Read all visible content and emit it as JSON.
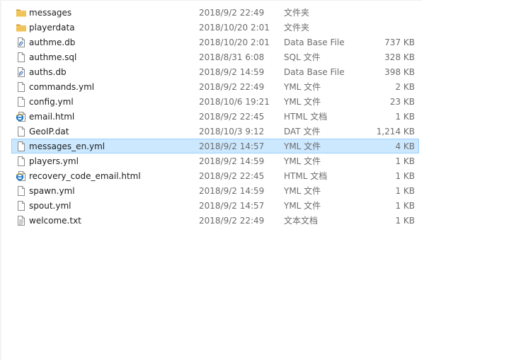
{
  "files": [
    {
      "name": "messages",
      "date": "2018/9/2 22:49",
      "type": "文件夹",
      "size": "",
      "icon": "folder-icon"
    },
    {
      "name": "playerdata",
      "date": "2018/10/20 2:01",
      "type": "文件夹",
      "size": "",
      "icon": "folder-icon"
    },
    {
      "name": "authme.db",
      "date": "2018/10/20 2:01",
      "type": "Data Base File",
      "size": "737 KB",
      "icon": "database-file-icon"
    },
    {
      "name": "authme.sql",
      "date": "2018/8/31 6:08",
      "type": "SQL 文件",
      "size": "328 KB",
      "icon": "file-icon"
    },
    {
      "name": "auths.db",
      "date": "2018/9/2 14:59",
      "type": "Data Base File",
      "size": "398 KB",
      "icon": "database-file-icon"
    },
    {
      "name": "commands.yml",
      "date": "2018/9/2 22:49",
      "type": "YML 文件",
      "size": "2 KB",
      "icon": "file-icon"
    },
    {
      "name": "config.yml",
      "date": "2018/10/6 19:21",
      "type": "YML 文件",
      "size": "23 KB",
      "icon": "file-icon"
    },
    {
      "name": "email.html",
      "date": "2018/9/2 22:45",
      "type": "HTML 文档",
      "size": "1 KB",
      "icon": "html-file-icon"
    },
    {
      "name": "GeoIP.dat",
      "date": "2018/10/3 9:12",
      "type": "DAT 文件",
      "size": "1,214 KB",
      "icon": "file-icon"
    },
    {
      "name": "messages_en.yml",
      "date": "2018/9/2 14:57",
      "type": "YML 文件",
      "size": "4 KB",
      "icon": "file-icon",
      "selected": true
    },
    {
      "name": "players.yml",
      "date": "2018/9/2 14:59",
      "type": "YML 文件",
      "size": "1 KB",
      "icon": "file-icon"
    },
    {
      "name": "recovery_code_email.html",
      "date": "2018/9/2 22:45",
      "type": "HTML 文档",
      "size": "1 KB",
      "icon": "html-file-icon"
    },
    {
      "name": "spawn.yml",
      "date": "2018/9/2 14:59",
      "type": "YML 文件",
      "size": "1 KB",
      "icon": "file-icon"
    },
    {
      "name": "spout.yml",
      "date": "2018/9/2 14:57",
      "type": "YML 文件",
      "size": "1 KB",
      "icon": "file-icon"
    },
    {
      "name": "welcome.txt",
      "date": "2018/9/2 22:49",
      "type": "文本文档",
      "size": "1 KB",
      "icon": "text-file-icon"
    }
  ],
  "colors": {
    "selection_bg": "#cce8ff",
    "selection_border": "#99d1ff",
    "folder": "#e8b54a",
    "folder_dark": "#d39a2a",
    "html_ie": "#1c76c9",
    "secondary_text": "#6d6d6d"
  }
}
